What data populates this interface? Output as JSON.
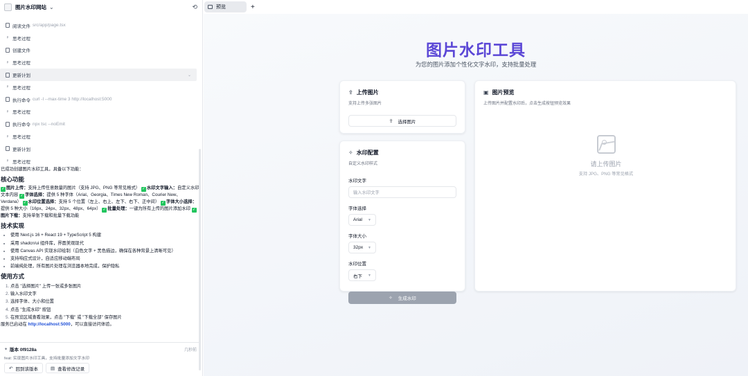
{
  "project": {
    "name": "图片水印网站"
  },
  "steps": [
    {
      "kind": "file",
      "label": "阅读文件",
      "arg": "src/app/page.tsx"
    },
    {
      "kind": "think",
      "label": "思考过程",
      "arg": ""
    },
    {
      "kind": "file",
      "label": "创建文件",
      "arg": ""
    },
    {
      "kind": "think",
      "label": "思考过程",
      "arg": ""
    },
    {
      "kind": "plan",
      "label": "更新计划",
      "arg": ""
    },
    {
      "kind": "think",
      "label": "思考过程",
      "arg": ""
    },
    {
      "kind": "cmd",
      "label": "执行命令",
      "arg": "curl -I --max-time 3 http://localhost:5000"
    },
    {
      "kind": "think",
      "label": "思考过程",
      "arg": ""
    },
    {
      "kind": "cmd",
      "label": "执行命令",
      "arg": "npx tsc --noEmit"
    },
    {
      "kind": "think",
      "label": "思考过程",
      "arg": ""
    },
    {
      "kind": "plan",
      "label": "更新计划",
      "arg": ""
    },
    {
      "kind": "think",
      "label": "思考过程",
      "arg": ""
    }
  ],
  "summary": {
    "intro": "已成功创建图片水印工具，具备以下功能：",
    "h_core": "核心功能",
    "features": [
      {
        "b": "图片上传：",
        "t": "支持上传任意数量的图片（支持 JPG、PNG 等常见格式）"
      },
      {
        "b": "水印文字输入：",
        "t": "自定义水印文本内容"
      },
      {
        "b": "字体选择：",
        "t": "提供 5 种字体（Arial、Georgia、Times New Roman、Courier New、Verdana）"
      },
      {
        "b": "水印位置选择：",
        "t": "支持 5 个位置（左上、右上、左下、右下、正中间）"
      },
      {
        "b": "字体大小选择：",
        "t": "提供 5 种大小（16px、24px、32px、48px、64px）"
      },
      {
        "b": "批量处理：",
        "t": "一键为所有上传的图片添加水印"
      },
      {
        "b": "图片下载：",
        "t": "支持单张下载和批量下载功能"
      }
    ],
    "h_tech": "技术实现",
    "tech": [
      "使用 Next.js 16 + React 19 + TypeScript 5 构建",
      "采用 shadcn/ui 组件库，界面美观现代",
      "使用 Canvas API 实现水印绘制（白色文字 + 黑色描边，确保在各种背景上清晰可见）",
      "支持响应式设计，自适应移动端布局",
      "前端纯处理，所有图片处理在浏览器本地完成，保护隐私"
    ],
    "h_usage": "使用方式",
    "usage": [
      "点击 \"选择图片\" 上传一张或多张图片",
      "输入水印文字",
      "选择字体、大小和位置",
      "点击 \"生成水印\" 按钮",
      "在预览区域查看效果，点击 \"下载\" 或 \"下载全部\" 保存图片"
    ],
    "server_prefix": "服务已启动在 ",
    "server_link": "http://localhost:5000",
    "server_suffix": "，可以直接访问体验。"
  },
  "version": {
    "title": "版本 0f9128a",
    "time": "几秒前",
    "desc": "feat: 实现图片水印工具，支持批量添加文字水印",
    "btn_restore": "回到该版本",
    "btn_changes": "查看修改记录"
  },
  "tab": {
    "label": "预览"
  },
  "hero": {
    "title": "图片水印工具",
    "subtitle": "为您的图片添加个性化文字水印，支持批量处理"
  },
  "upload": {
    "title": "上传图片",
    "subtitle": "支持上传多张图片",
    "button": "选择图片"
  },
  "config": {
    "title": "水印配置",
    "subtitle": "自定义水印样式",
    "text_label": "水印文字",
    "text_placeholder": "输入水印文字",
    "font_label": "字体选择",
    "font_value": "Arial",
    "size_label": "字体大小",
    "size_value": "32px",
    "pos_label": "水印位置",
    "pos_value": "右下",
    "generate": "生成水印"
  },
  "preview": {
    "title": "图片预览",
    "subtitle": "上传图片并配置水印后，点击生成按钮预览效果",
    "empty_title": "请上传图片",
    "empty_sub": "支持 JPG、PNG 等常见格式"
  },
  "colors": {
    "accent": "#5b47d6",
    "success": "#22c55e",
    "link": "#1d4ed8",
    "disabled_btn": "#9ca3af"
  }
}
